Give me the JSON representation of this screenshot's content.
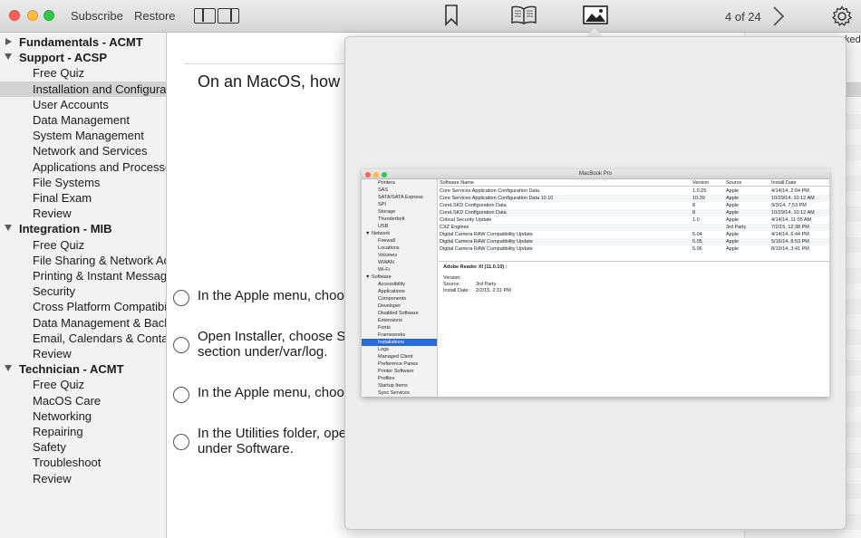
{
  "toolbar": {
    "subscribe_label": "Subscribe",
    "restore_label": "Restore",
    "page_counter": "4 of 24"
  },
  "sidebar": {
    "sections": [
      {
        "label": "Fundamentals - ACMT",
        "expanded": false,
        "items": []
      },
      {
        "label": "Support - ACSP",
        "expanded": true,
        "items": [
          "Free Quiz",
          "Installation and Configuration",
          "User Accounts",
          "Data Management",
          "System Management",
          "Network and Services",
          "Applications and Processes",
          "File Systems",
          "Final Exam",
          "Review"
        ]
      },
      {
        "label": "Integration - MIB",
        "expanded": true,
        "items": [
          "Free Quiz",
          "File Sharing & Network Access",
          "Printing & Instant Messaging",
          "Security",
          "Cross Platform Compatibility",
          "Data Management & Backup",
          "Email, Calendars & Contacts",
          "Review"
        ]
      },
      {
        "label": "Technician - ACMT",
        "expanded": true,
        "items": [
          "Free Quiz",
          "MacOS Care",
          "Networking",
          "Repairing",
          "Safety",
          "Troubleshoot",
          "Review"
        ]
      }
    ],
    "selected_item": "Installation and Configuration"
  },
  "main": {
    "question": "On an MacOS, how c",
    "answers": [
      "In the Apple menu, choo",
      "Open Installer, choose S\nsection under/var/log.",
      "In the Apple menu, choo",
      "In the Utilities folder, ope\nunder Software."
    ],
    "right_partial": "ked"
  },
  "popover": {
    "screenshot": {
      "window_title": "MacBook Pro",
      "sidebar_items": [
        "Printers",
        "SAS",
        "SATA/SATA Express",
        "SPI",
        "Storage",
        "Thunderbolt",
        "USB",
        "▼ Network",
        "Firewall",
        "Locations",
        "Volumes",
        "WWAN",
        "Wi-Fi",
        "▼ Software",
        "Accessibility",
        "Applications",
        "Components",
        "Developer",
        "Disabled Software",
        "Extensions",
        "Fonts",
        "Frameworks",
        "Installations",
        "Logs",
        "Managed Client",
        "Preference Panes",
        "Printer Software",
        "Profiles",
        "Startup Items",
        "Sync Services"
      ],
      "selected_sidebar": "Installations",
      "columns": [
        "Software Name",
        "Version",
        "Source",
        "Install Date"
      ],
      "rows": [
        [
          "Core Services Application Configuration Data",
          "1.0.25",
          "Apple",
          "4/14/14, 2:04 PM"
        ],
        [
          "Core Services Application Configuration Data 10.10",
          "10.39",
          "Apple",
          "10/29/14, 10:12 AM"
        ],
        [
          "CoreLSKD Configuration Data",
          "8",
          "Apple",
          "9/3/14, 7:53 PM"
        ],
        [
          "CoreLSKD Configuration Data",
          "8",
          "Apple",
          "10/29/14, 10:12 AM"
        ],
        [
          "Critical Security Update",
          "1.0",
          "Apple",
          "4/14/14, 11:05 AM"
        ],
        [
          "CXZ Engines",
          "",
          "3rd Party",
          "7/2/15, 12:38 PM"
        ],
        [
          "Digital Camera RAW Compatibility Update",
          "5.04",
          "Apple",
          "4/14/14, 6:44 PM"
        ],
        [
          "Digital Camera RAW Compatibility Update",
          "5.05",
          "Apple",
          "5/16/14, 8:53 PM"
        ],
        [
          "Digital Camera RAW Compatibility Update",
          "5.06",
          "Apple",
          "8/19/14, 3:41 PM"
        ]
      ],
      "detail_title": "Adobe Reader XI (11.0.10) :",
      "detail_version_label": "Version:",
      "detail_source_label": "Source:",
      "detail_source": "3rd Party",
      "detail_date_label": "Install Date:",
      "detail_date": "2/2/15, 2:31 PM"
    }
  }
}
